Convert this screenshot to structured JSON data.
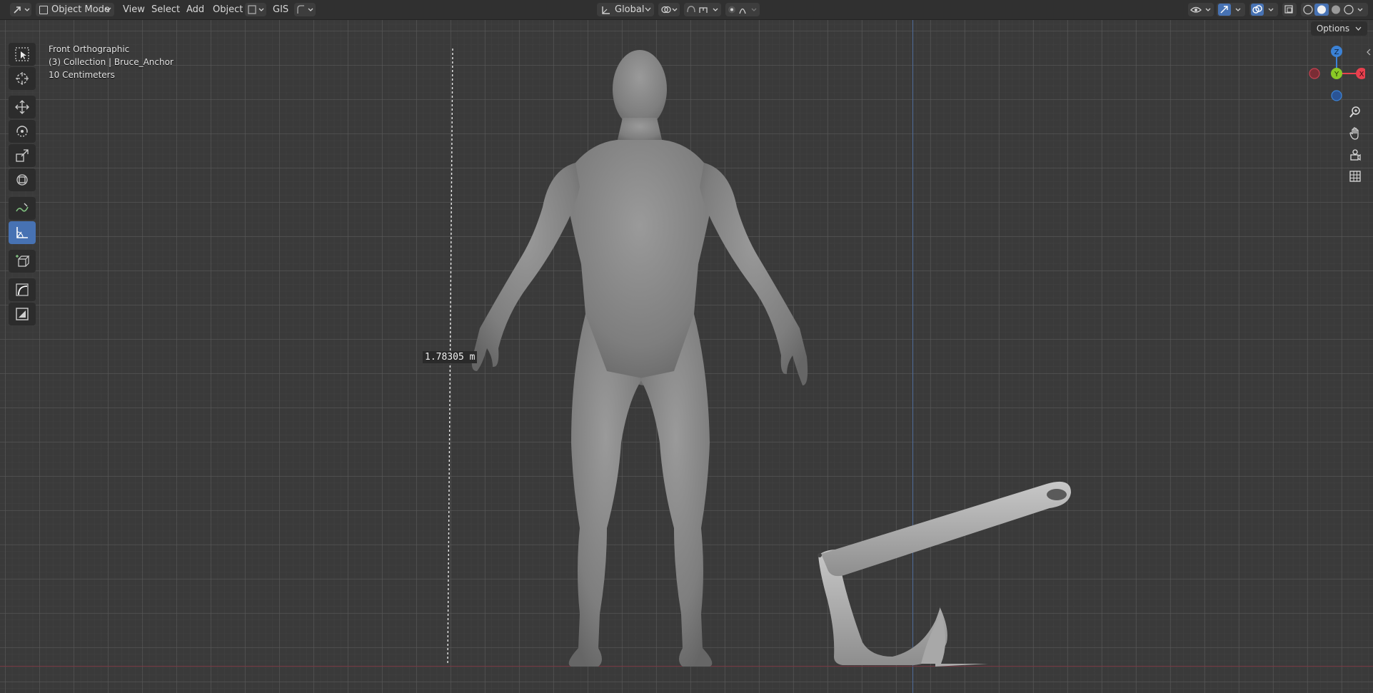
{
  "header": {
    "mode_label": "Object Mode",
    "menus": [
      "View",
      "Select",
      "Add",
      "Object"
    ],
    "gis_label": "GIS",
    "transform_orientation": "Global",
    "options_label": "Options"
  },
  "viewport": {
    "view_name": "Front Orthographic",
    "collection_info": "(3) Collection | Bruce_Anchor",
    "grid_scale": "10 Centimeters",
    "measurement": "1.78305 m"
  },
  "toolbar": {
    "tools": [
      "select-box",
      "cursor",
      "move",
      "rotate",
      "scale",
      "transform",
      "annotate",
      "measure",
      "add-cube",
      "bevel",
      "extrude"
    ],
    "active_tool": "measure"
  },
  "gizmo": {
    "z_label": "Z",
    "y_label": "Y",
    "x_label": "X",
    "colors": {
      "x": "#e8404e",
      "y": "#8ac926",
      "z": "#3b82d6"
    }
  },
  "colors": {
    "accent": "#4772b3",
    "header_bg": "#303030",
    "viewport_bg": "#3a3a3a"
  }
}
